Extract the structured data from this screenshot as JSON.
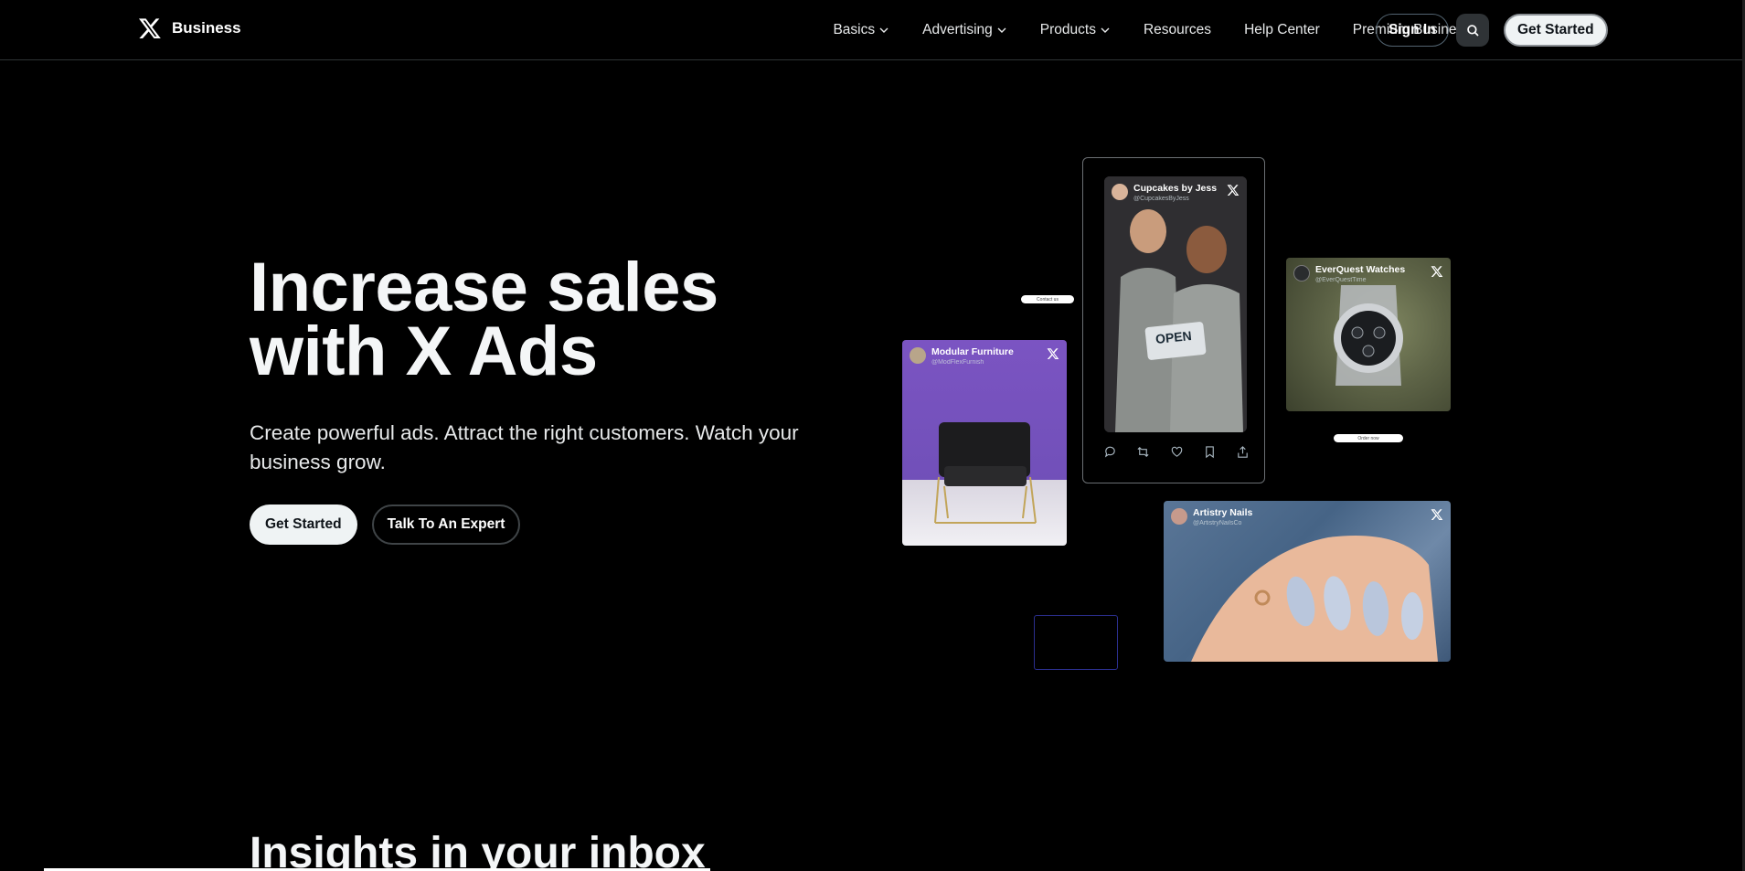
{
  "nav": {
    "brand": "Business",
    "links": [
      {
        "label": "Basics",
        "dropdown": true
      },
      {
        "label": "Advertising",
        "dropdown": true
      },
      {
        "label": "Products",
        "dropdown": true
      },
      {
        "label": "Resources",
        "dropdown": false
      },
      {
        "label": "Help Center",
        "dropdown": false
      },
      {
        "label": "Premium Business",
        "dropdown": false
      }
    ],
    "sign_in": "Sign In",
    "get_started": "Get Started"
  },
  "hero": {
    "title": "Increase sales with X Ads",
    "subtitle": "Create powerful ads. Attract the right customers. Watch your business grow.",
    "cta_primary": "Get Started",
    "cta_secondary": "Talk To An Expert"
  },
  "ads": {
    "phone": {
      "name": "Cupcakes by Jess",
      "handle": "@CupcakesByJess",
      "sign_text": "OPEN"
    },
    "furniture": {
      "name": "Modular Furniture",
      "handle": "@ModFlexFurnish"
    },
    "watches": {
      "name": "EverQuest Watches",
      "handle": "@EverQuestTime"
    },
    "nails": {
      "name": "Artistry Nails",
      "handle": "@ArtistryNailsCo"
    },
    "contact_pill": "Contact us",
    "order_pill": "Order now"
  },
  "insights": {
    "title": "Insights in your inbox"
  },
  "colors": {
    "background": "#000000",
    "text": "#e7e9ea",
    "button_light": "#eff3f4",
    "border": "#2f3336"
  }
}
